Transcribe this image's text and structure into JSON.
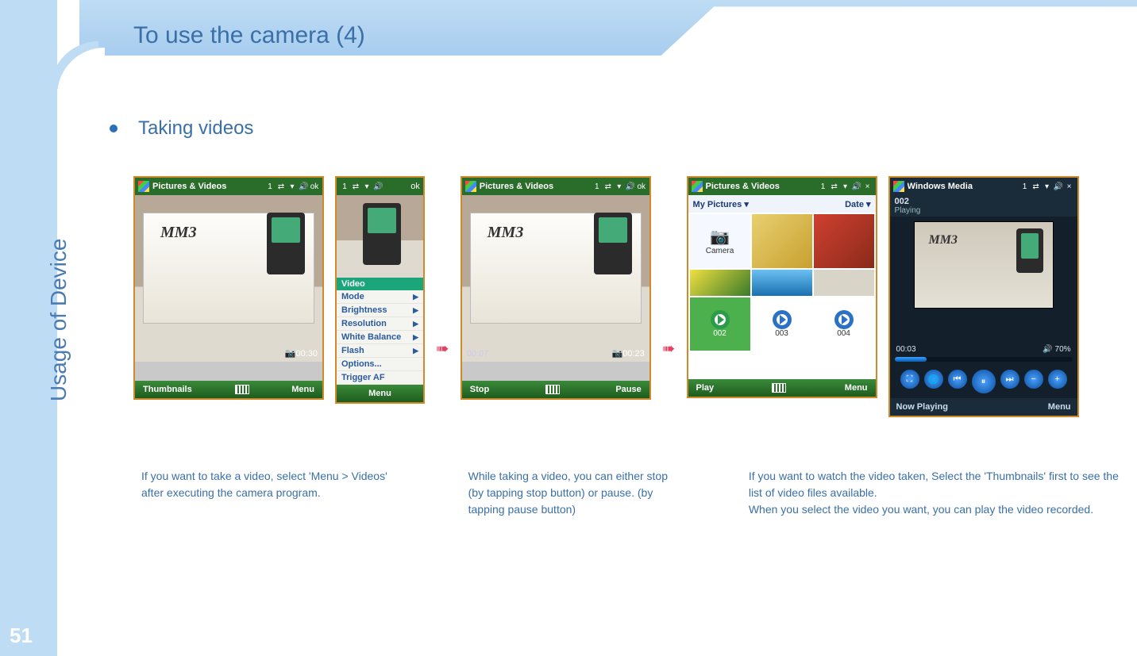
{
  "page": {
    "title": "To use the camera (4)",
    "sidebar_label": "Usage of Device",
    "page_number": "51",
    "bullet": "Taking videos"
  },
  "screenshots": {
    "s1": {
      "titlebar": "Pictures & Videos",
      "tb_right": "ok",
      "timer_right": "00:30",
      "soft_left": "Thumbnails",
      "soft_right": "Menu",
      "mm3": "MM3"
    },
    "s1b": {
      "tb_right": "ok",
      "menu_header": "Video",
      "menu_items": [
        "Mode",
        "Brightness",
        "Resolution",
        "White Balance",
        "Flash",
        "Options...",
        "Trigger AF"
      ],
      "soft": "Menu"
    },
    "s2": {
      "titlebar": "Pictures & Videos",
      "tb_right": "ok",
      "timer_left": "00:07",
      "timer_right": "00:23",
      "soft_left": "Stop",
      "soft_right": "Pause",
      "mm3": "MM3"
    },
    "s3": {
      "titlebar": "Pictures & Videos",
      "tb_right": "×",
      "sub_left": "My Pictures",
      "sub_right": "Date",
      "thumbs": {
        "camera_label": "Camera",
        "v1": "002",
        "v2": "003",
        "v3": "004"
      },
      "soft_left": "Play",
      "soft_right": "Menu"
    },
    "s4": {
      "titlebar": "Windows Media",
      "tb_right": "×",
      "clip_name": "002",
      "clip_state": "Playing",
      "time": "00:03",
      "volume": "70%",
      "soft_left": "Now Playing",
      "soft_right": "Menu",
      "mm3": "MM3"
    }
  },
  "captions": {
    "c1": "If you want to take a video, select 'Menu > Videos' after executing the camera program.",
    "c2": "While taking a video, you can either stop (by tapping stop button) or pause. (by tapping pause button)",
    "c3a": "If you want to watch the video taken, Select the 'Thumbnails' first to see the list of video files available.",
    "c3b": "When you select the video you want, you can play the video recorded."
  }
}
